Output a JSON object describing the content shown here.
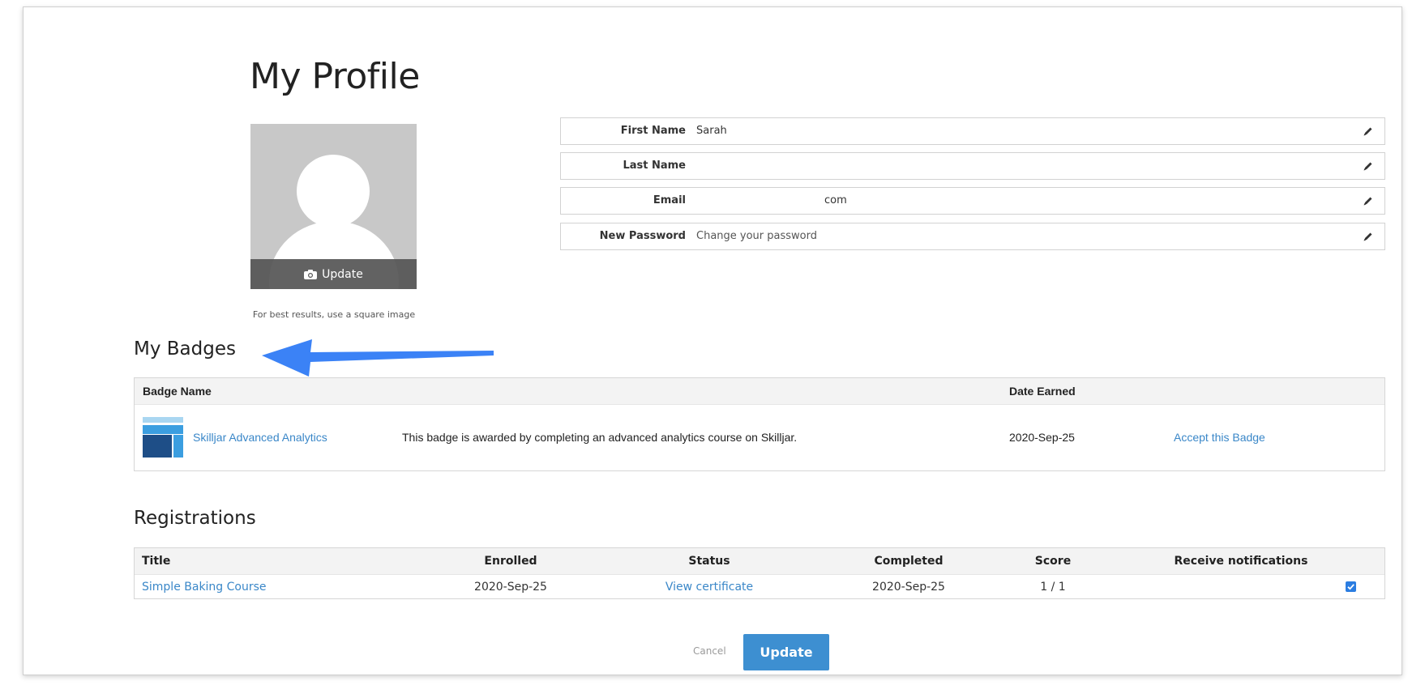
{
  "page": {
    "title": "My Profile"
  },
  "avatar": {
    "update_label": "Update",
    "hint": "For best results, use a square image"
  },
  "profile_fields": {
    "first_name": {
      "label": "First Name",
      "value": "Sarah"
    },
    "last_name": {
      "label": "Last Name",
      "value": ""
    },
    "email": {
      "label": "Email",
      "value": "com"
    },
    "password": {
      "label": "New Password",
      "placeholder": "Change your password"
    }
  },
  "badges": {
    "title": "My Badges",
    "columns": {
      "name": "Badge Name",
      "date": "Date Earned"
    },
    "rows": [
      {
        "name": "Skilljar Advanced Analytics",
        "description": "This badge is awarded by completing an advanced analytics course on Skilljar.",
        "date": "2020-Sep-25",
        "action": "Accept this Badge"
      }
    ]
  },
  "registrations": {
    "title": "Registrations",
    "columns": {
      "title": "Title",
      "enrolled": "Enrolled",
      "status": "Status",
      "completed": "Completed",
      "score": "Score",
      "notifications": "Receive notifications"
    },
    "rows": [
      {
        "title": "Simple Baking Course",
        "enrolled": "2020-Sep-25",
        "status": "View certificate",
        "completed": "2020-Sep-25",
        "score": "1 / 1",
        "notifications": true
      }
    ]
  },
  "actions": {
    "cancel": "Cancel",
    "update": "Update"
  },
  "colors": {
    "link": "#3a87c8",
    "primary_button": "#3d8fd1",
    "annotation_arrow": "#3b82f6"
  },
  "icons": [
    "camera-icon",
    "pencil-icon",
    "badge-logo-icon",
    "checkbox-checked-icon",
    "annotation-arrow"
  ]
}
